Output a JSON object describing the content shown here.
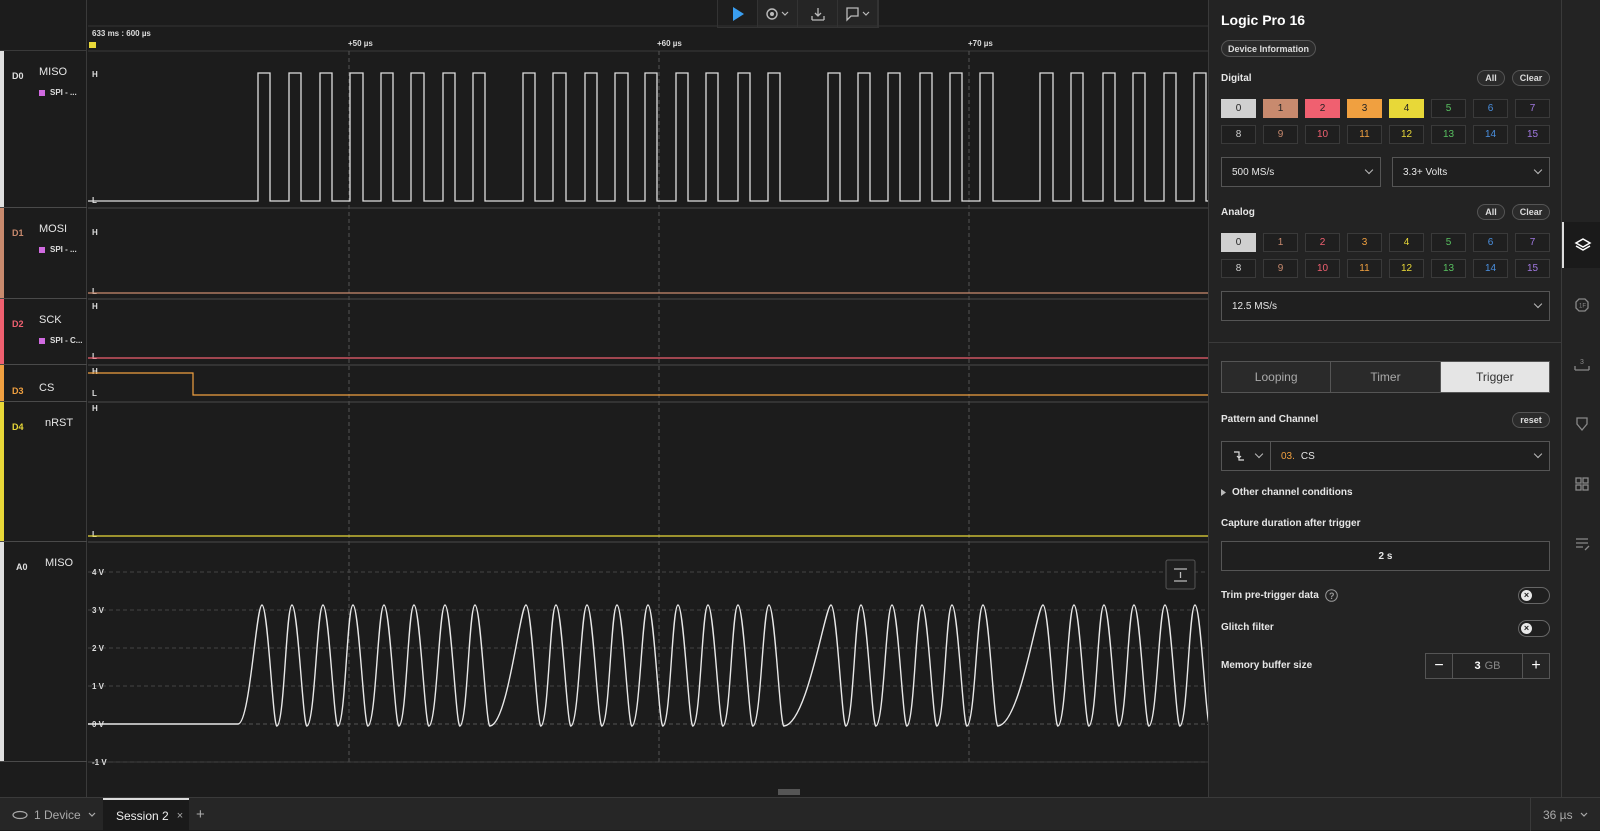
{
  "toolbar": {
    "items": [
      {
        "icon": "play-icon"
      },
      {
        "icon": "settings-dropdown-icon"
      },
      {
        "icon": "timing-marker-icon"
      },
      {
        "icon": "annotation-dropdown-icon"
      }
    ]
  },
  "ruler": {
    "start_label": "633 ms : 600 µs",
    "ticks": [
      "+50 µs",
      "+60 µs",
      "+70 µs"
    ]
  },
  "channels": [
    {
      "num": "D0",
      "name": "MISO",
      "analyzer": "SPI - ...",
      "color": "#e0e0e0"
    },
    {
      "num": "D1",
      "name": "MOSI",
      "analyzer": "SPI - ...",
      "color": "#c88a6e"
    },
    {
      "num": "D2",
      "name": "SCK",
      "analyzer": "SPI - C...",
      "color": "#f06070"
    },
    {
      "num": "D3",
      "name": "CS",
      "analyzer": "",
      "color": "#f0a040"
    },
    {
      "num": "D4",
      "name": "nRST",
      "analyzer": "",
      "color": "#e8d838"
    },
    {
      "num": "A0",
      "name": "MISO",
      "analyzer": "",
      "color": "#e0e0e0"
    }
  ],
  "levels": {
    "high": "H",
    "low": "L"
  },
  "analog_axis": [
    "4 V",
    "3 V",
    "2 V",
    "1 V",
    "0 V",
    "-1 V"
  ],
  "panel": {
    "title": "Logic Pro 16",
    "device_info": "Device Information",
    "digital_label": "Digital",
    "analog_label": "Analog",
    "all": "All",
    "clear": "Clear",
    "channel_numbers": [
      "0",
      "1",
      "2",
      "3",
      "4",
      "5",
      "6",
      "7",
      "8",
      "9",
      "10",
      "11",
      "12",
      "13",
      "14",
      "15"
    ],
    "channel_colors": [
      "#d0d0d0",
      "#c88a6e",
      "#f06070",
      "#f0a040",
      "#e8d838",
      "#58c060",
      "#4a90e0",
      "#a078e0",
      "#d0d0d0",
      "#c88a6e",
      "#f06070",
      "#f0a040",
      "#e8d838",
      "#58c060",
      "#4a90e0",
      "#a078e0"
    ],
    "digital_rate": "500 MS/s",
    "voltage": "3.3+ Volts",
    "analog_rate": "12.5 MS/s",
    "modes": [
      "Looping",
      "Timer",
      "Trigger"
    ],
    "active_mode": "Trigger",
    "pattern_label": "Pattern and Channel",
    "reset": "reset",
    "trigger_channel_num": "03.",
    "trigger_channel_name": "CS",
    "other_conditions": "Other channel conditions",
    "capture_label": "Capture duration after trigger",
    "capture_value": "2 s",
    "trim_label": "Trim pre-trigger data",
    "glitch_label": "Glitch filter",
    "memory_label": "Memory buffer size",
    "memory_value": "3",
    "memory_unit": "GB",
    "minus": "−",
    "plus": "+"
  },
  "bottom": {
    "device_tab": "1 Device",
    "session_tab": "Session 2",
    "close": "×",
    "add": "+",
    "zoom": "36 µs"
  }
}
